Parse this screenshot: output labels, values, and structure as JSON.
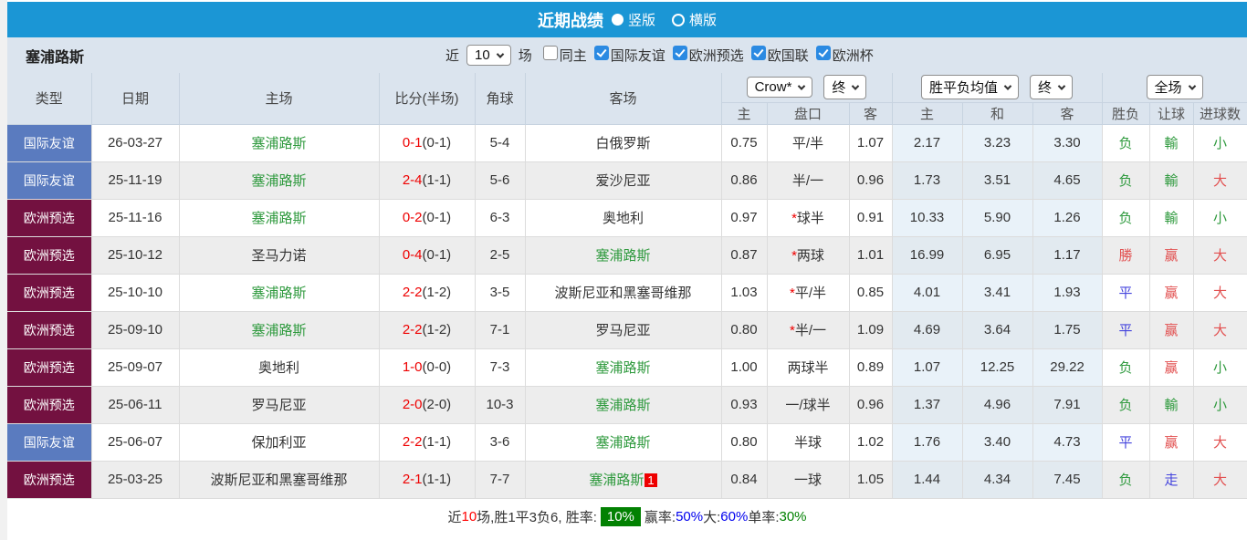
{
  "colors": {
    "accent_blue": "#1b96d5",
    "type_blue": "#5a7bbf",
    "type_maroon": "#731140",
    "score_red": "#ee0000",
    "team_green": "#2f9a3e",
    "win_red": "#e25050",
    "draw_blue": "#4545dd",
    "badge_green": "#028102"
  },
  "title_bar": {
    "title": "近期战绩",
    "layout_options": [
      {
        "label": "竖版",
        "selected": true
      },
      {
        "label": "横版",
        "selected": false
      }
    ]
  },
  "filter_bar": {
    "team_name": "塞浦路斯",
    "recent_label": "近",
    "recent_count": "10",
    "recent_suffix": "场",
    "filters": [
      {
        "label": "同主",
        "checked": false
      },
      {
        "label": "国际友谊",
        "checked": true
      },
      {
        "label": "欧洲预选",
        "checked": true
      },
      {
        "label": "欧国联",
        "checked": true
      },
      {
        "label": "欧洲杯",
        "checked": true
      }
    ]
  },
  "table": {
    "main_headers": [
      "类型",
      "日期",
      "主场",
      "比分(半场)",
      "角球",
      "客场"
    ],
    "dropdowns": {
      "bookmaker": "Crow*",
      "bookmaker_state": "终",
      "euro_avg": "胜平负均值",
      "euro_state": "终",
      "scope": "全场"
    },
    "sub_headers": [
      "主",
      "盘口",
      "客",
      "主",
      "和",
      "客",
      "胜负",
      "让球",
      "进球数"
    ],
    "rows": [
      {
        "type": "国际友谊",
        "type_color": "blue",
        "date": "26-03-27",
        "home": "塞浦路斯",
        "home_highlight": true,
        "score_ft": "0-1",
        "score_ht": "(0-1)",
        "corners": "5-4",
        "away": "白俄罗斯",
        "away_highlight": false,
        "away_badge": "",
        "asian_home": "0.75",
        "handicap_prefix": "",
        "handicap": "平/半",
        "asian_away": "1.07",
        "euro_home": "2.17",
        "euro_draw": "3.23",
        "euro_away": "3.30",
        "result_wdl": {
          "text": "负",
          "color": "green"
        },
        "result_handicap": {
          "text": "輸",
          "color": "green"
        },
        "result_goals": {
          "text": "小",
          "color": "green"
        }
      },
      {
        "type": "国际友谊",
        "type_color": "blue",
        "date": "25-11-19",
        "home": "塞浦路斯",
        "home_highlight": true,
        "score_ft": "2-4",
        "score_ht": "(1-1)",
        "corners": "5-6",
        "away": "爱沙尼亚",
        "away_highlight": false,
        "away_badge": "",
        "asian_home": "0.86",
        "handicap_prefix": "",
        "handicap": "半/一",
        "asian_away": "0.96",
        "euro_home": "1.73",
        "euro_draw": "3.51",
        "euro_away": "4.65",
        "result_wdl": {
          "text": "负",
          "color": "green"
        },
        "result_handicap": {
          "text": "輸",
          "color": "green"
        },
        "result_goals": {
          "text": "大",
          "color": "red"
        }
      },
      {
        "type": "欧洲预选",
        "type_color": "maroon",
        "date": "25-11-16",
        "home": "塞浦路斯",
        "home_highlight": true,
        "score_ft": "0-2",
        "score_ht": "(0-1)",
        "corners": "6-3",
        "away": "奥地利",
        "away_highlight": false,
        "away_badge": "",
        "asian_home": "0.97",
        "handicap_prefix": "*",
        "handicap": "球半",
        "asian_away": "0.91",
        "euro_home": "10.33",
        "euro_draw": "5.90",
        "euro_away": "1.26",
        "result_wdl": {
          "text": "负",
          "color": "green"
        },
        "result_handicap": {
          "text": "輸",
          "color": "green"
        },
        "result_goals": {
          "text": "小",
          "color": "green"
        }
      },
      {
        "type": "欧洲预选",
        "type_color": "maroon",
        "date": "25-10-12",
        "home": "圣马力诺",
        "home_highlight": false,
        "score_ft": "0-4",
        "score_ht": "(0-1)",
        "corners": "2-5",
        "away": "塞浦路斯",
        "away_highlight": true,
        "away_badge": "",
        "asian_home": "0.87",
        "handicap_prefix": "*",
        "handicap": "两球",
        "asian_away": "1.01",
        "euro_home": "16.99",
        "euro_draw": "6.95",
        "euro_away": "1.17",
        "result_wdl": {
          "text": "勝",
          "color": "red"
        },
        "result_handicap": {
          "text": "赢",
          "color": "red"
        },
        "result_goals": {
          "text": "大",
          "color": "red"
        }
      },
      {
        "type": "欧洲预选",
        "type_color": "maroon",
        "date": "25-10-10",
        "home": "塞浦路斯",
        "home_highlight": true,
        "score_ft": "2-2",
        "score_ht": "(1-2)",
        "corners": "3-5",
        "away": "波斯尼亚和黑塞哥维那",
        "away_highlight": false,
        "away_badge": "",
        "asian_home": "1.03",
        "handicap_prefix": "*",
        "handicap": "平/半",
        "asian_away": "0.85",
        "euro_home": "4.01",
        "euro_draw": "3.41",
        "euro_away": "1.93",
        "result_wdl": {
          "text": "平",
          "color": "blue"
        },
        "result_handicap": {
          "text": "赢",
          "color": "red"
        },
        "result_goals": {
          "text": "大",
          "color": "red"
        }
      },
      {
        "type": "欧洲预选",
        "type_color": "maroon",
        "date": "25-09-10",
        "home": "塞浦路斯",
        "home_highlight": true,
        "score_ft": "2-2",
        "score_ht": "(1-2)",
        "corners": "7-1",
        "away": "罗马尼亚",
        "away_highlight": false,
        "away_badge": "",
        "asian_home": "0.80",
        "handicap_prefix": "*",
        "handicap": "半/一",
        "asian_away": "1.09",
        "euro_home": "4.69",
        "euro_draw": "3.64",
        "euro_away": "1.75",
        "result_wdl": {
          "text": "平",
          "color": "blue"
        },
        "result_handicap": {
          "text": "赢",
          "color": "red"
        },
        "result_goals": {
          "text": "大",
          "color": "red"
        }
      },
      {
        "type": "欧洲预选",
        "type_color": "maroon",
        "date": "25-09-07",
        "home": "奥地利",
        "home_highlight": false,
        "score_ft": "1-0",
        "score_ht": "(0-0)",
        "corners": "7-3",
        "away": "塞浦路斯",
        "away_highlight": true,
        "away_badge": "",
        "asian_home": "1.00",
        "handicap_prefix": "",
        "handicap": "两球半",
        "asian_away": "0.89",
        "euro_home": "1.07",
        "euro_draw": "12.25",
        "euro_away": "29.22",
        "result_wdl": {
          "text": "负",
          "color": "green"
        },
        "result_handicap": {
          "text": "赢",
          "color": "red"
        },
        "result_goals": {
          "text": "小",
          "color": "green"
        }
      },
      {
        "type": "欧洲预选",
        "type_color": "maroon",
        "date": "25-06-11",
        "home": "罗马尼亚",
        "home_highlight": false,
        "score_ft": "2-0",
        "score_ht": "(2-0)",
        "corners": "10-3",
        "away": "塞浦路斯",
        "away_highlight": true,
        "away_badge": "",
        "asian_home": "0.93",
        "handicap_prefix": "",
        "handicap": "一/球半",
        "asian_away": "0.96",
        "euro_home": "1.37",
        "euro_draw": "4.96",
        "euro_away": "7.91",
        "result_wdl": {
          "text": "负",
          "color": "green"
        },
        "result_handicap": {
          "text": "輸",
          "color": "green"
        },
        "result_goals": {
          "text": "小",
          "color": "green"
        }
      },
      {
        "type": "国际友谊",
        "type_color": "blue",
        "date": "25-06-07",
        "home": "保加利亚",
        "home_highlight": false,
        "score_ft": "2-2",
        "score_ht": "(1-1)",
        "corners": "3-6",
        "away": "塞浦路斯",
        "away_highlight": true,
        "away_badge": "",
        "asian_home": "0.80",
        "handicap_prefix": "",
        "handicap": "半球",
        "asian_away": "1.02",
        "euro_home": "1.76",
        "euro_draw": "3.40",
        "euro_away": "4.73",
        "result_wdl": {
          "text": "平",
          "color": "blue"
        },
        "result_handicap": {
          "text": "赢",
          "color": "red"
        },
        "result_goals": {
          "text": "大",
          "color": "red"
        }
      },
      {
        "type": "欧洲预选",
        "type_color": "maroon",
        "date": "25-03-25",
        "home": "波斯尼亚和黑塞哥维那",
        "home_highlight": false,
        "score_ft": "2-1",
        "score_ht": "(1-1)",
        "corners": "7-7",
        "away": "塞浦路斯",
        "away_highlight": true,
        "away_badge": "1",
        "asian_home": "0.84",
        "handicap_prefix": "",
        "handicap": "一球",
        "asian_away": "1.05",
        "euro_home": "1.44",
        "euro_draw": "4.34",
        "euro_away": "7.45",
        "result_wdl": {
          "text": "负",
          "color": "green"
        },
        "result_handicap": {
          "text": "走",
          "color": "blue"
        },
        "result_goals": {
          "text": "大",
          "color": "red"
        }
      }
    ]
  },
  "footer": {
    "segments": [
      {
        "text": "近",
        "style": "default"
      },
      {
        "text": "10",
        "style": "red"
      },
      {
        "text": "场,胜1平3负6, 胜率:",
        "style": "default"
      },
      {
        "text": "10%",
        "style": "badge"
      },
      {
        "text": "赢率:",
        "style": "default"
      },
      {
        "text": "50%",
        "style": "blue"
      },
      {
        "text": " 大:",
        "style": "default"
      },
      {
        "text": "60%",
        "style": "blue"
      },
      {
        "text": " 单率:",
        "style": "default"
      },
      {
        "text": "30%",
        "style": "green"
      }
    ]
  }
}
